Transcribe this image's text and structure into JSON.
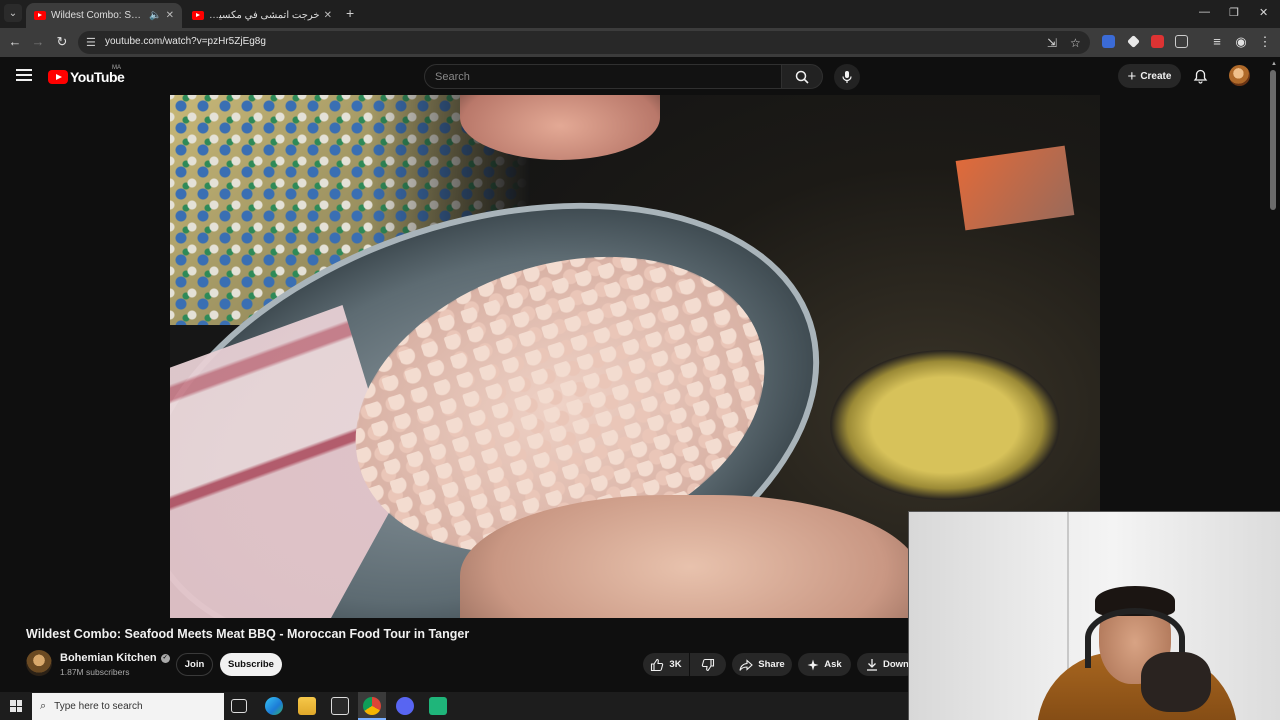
{
  "browser": {
    "tabs": [
      {
        "title": "Wildest Combo: Seafood M",
        "active": true
      },
      {
        "title": "خرجت أتمشى في مكسيكو... ولعد",
        "active": false
      }
    ],
    "url": "youtube.com/watch?v=pzHr5ZjEg8g"
  },
  "youtube": {
    "logo_text": "YouTube",
    "country_code": "MA",
    "search_placeholder": "Search",
    "create_label": "Create"
  },
  "video": {
    "title": "Wildest Combo: Seafood Meets Meat BBQ - Moroccan Food Tour in Tanger",
    "channel_name": "Bohemian Kitchen",
    "subscribers": "1.87M subscribers",
    "join_label": "Join",
    "subscribe_label": "Subscribe",
    "likes": "3K",
    "share_label": "Share",
    "ask_label": "Ask",
    "download_label": "Down"
  },
  "taskbar": {
    "search_placeholder": "Type here to search"
  },
  "colors": {
    "youtube_red": "#ff0000",
    "background": "#0f0f0f",
    "chip_bg": "#272727"
  }
}
